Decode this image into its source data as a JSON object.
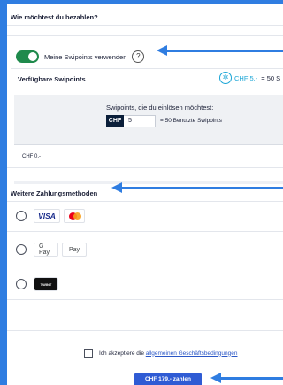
{
  "payment": {
    "title": "Wie möchtest du bezahlen?",
    "toggle_label": "Meine Swipoints verwenden",
    "help_symbol": "?",
    "swipoints_label": "Verfügbare Swipoints",
    "swipoints_chf": "CHF 5.-",
    "swipoints_equals": "= 50 S",
    "redeem_title": "Swipoints, die du einlösen möchtest:",
    "currency_tag": "CHF",
    "redeem_value": "5",
    "used_points": "= 50 Benutzte Swipoints",
    "remaining_chf": "CHF 0.-",
    "other_methods_label": "Weitere Zahlungsmethoden",
    "methods": {
      "visa": "VISA",
      "gpay": "G Pay",
      "applepay": " Pay",
      "twint": "TWINT"
    },
    "agree_text": "Ich akzeptiere die ",
    "agree_link": "allgemeinen Geschäftsbedingungen",
    "pay_button": "CHF 179.- zahlen"
  },
  "colors": {
    "accent": "#2f7de1",
    "toggle_on": "#1f8a4c",
    "pay_button": "#2f5bd4",
    "swipoints": "#1aa5d6"
  }
}
